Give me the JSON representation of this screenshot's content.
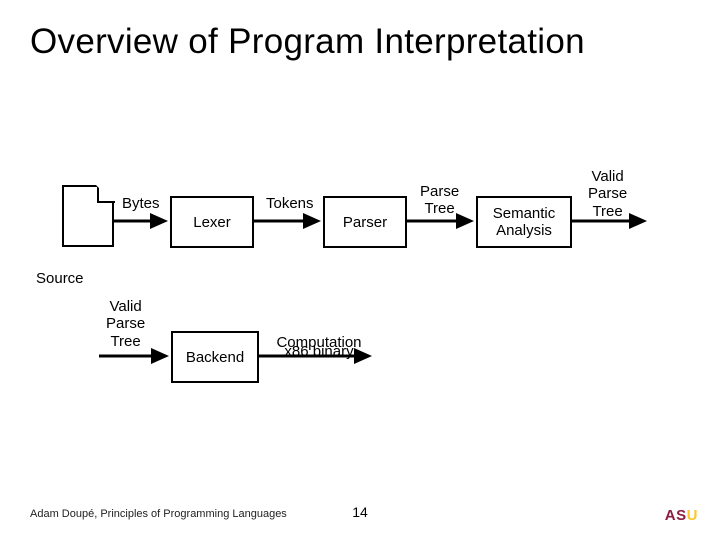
{
  "title": "Overview of Program Interpretation",
  "row1": {
    "source": "Source",
    "bytes": "Bytes",
    "lexer": "Lexer",
    "tokens": "Tokens",
    "parser": "Parser",
    "parse_tree": "Parse\nTree",
    "semantic": "Semantic\nAnalysis",
    "valid_parse_tree": "Valid\nParse\nTree"
  },
  "row2": {
    "valid_parse_tree": "Valid\nParse\nTree",
    "backend": "Backend",
    "output": "Computation\nx86 binary"
  },
  "footer": "Adam Doupé, Principles of Programming Languages",
  "slide_no": "14",
  "logo": {
    "a": "A",
    "s": "S",
    "u": "U"
  }
}
